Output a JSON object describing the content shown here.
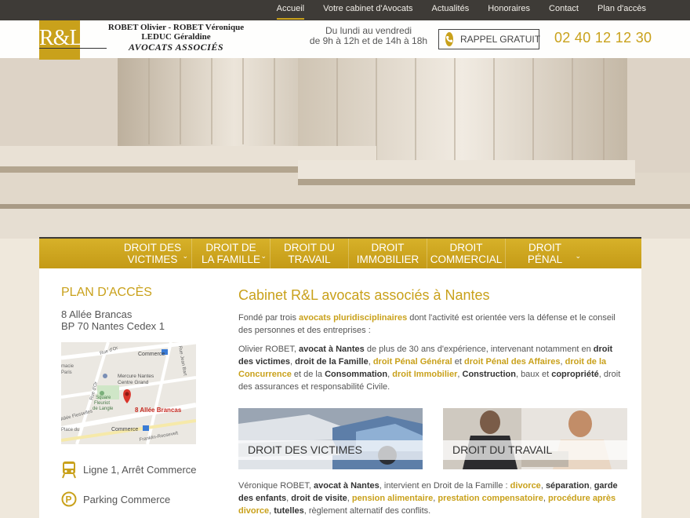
{
  "topnav": {
    "items": [
      {
        "label": "Accueil",
        "active": true
      },
      {
        "label": "Votre cabinet d'Avocats",
        "active": false
      },
      {
        "label": "Actualités",
        "active": false
      },
      {
        "label": "Honoraires",
        "active": false
      },
      {
        "label": "Contact",
        "active": false
      },
      {
        "label": "Plan d'accès",
        "active": false
      }
    ]
  },
  "header": {
    "logo_text": "R&L",
    "firm_line1": "ROBET Olivier - ROBET Véronique",
    "firm_line2": "LEDUC Géraldine",
    "firm_tagline": "AVOCATS ASSOCIÉS",
    "hours_line1": "Du lundi au vendredi",
    "hours_line2": "de 9h à 12h et de 14h à 18h",
    "callback_label": "RAPPEL GRATUIT",
    "phone": "02 40 12 12 30"
  },
  "practice_menu": [
    {
      "line1": "DROIT DES",
      "line2": "VICTIMES",
      "has_dropdown": true
    },
    {
      "line1": "DROIT DE",
      "line2": "LA FAMILLE",
      "has_dropdown": true
    },
    {
      "line1": "DROIT DU",
      "line2": "TRAVAIL",
      "has_dropdown": false
    },
    {
      "line1": "DROIT",
      "line2": "IMMOBILIER",
      "has_dropdown": false
    },
    {
      "line1": "DROIT",
      "line2": "COMMERCIAL",
      "has_dropdown": false
    },
    {
      "line1": "DROIT",
      "line2": "PÉNAL",
      "has_dropdown": true
    }
  ],
  "sidebar": {
    "title": "PLAN D'ACCÈS",
    "address_line1": "8 Allée Brancas",
    "address_line2": "BP 70 Nantes Cedex 1",
    "map_labels": {
      "commerce": "Commerce",
      "rue": "Rue d'Or",
      "hotel_line1": "Mercure Nantes",
      "hotel_line2": "Centre Grand",
      "square_line1": "Square",
      "square_line2": "Fleuriot",
      "square_line3": "de Langle",
      "pin_label": "8 Allée Brancas",
      "commerce2": "Commerce",
      "roosevelt": "Franklin-Roosevelt",
      "pharmacie": "macie",
      "paris": "Paris",
      "rue_jean": "Rue Jean Bart",
      "allee": "Allée Flesselles",
      "place": "Place du",
      "rue_oret": "Rue d'Or"
    },
    "transport": [
      {
        "icon": "tram-icon",
        "label": "Ligne 1, Arrêt Commerce"
      },
      {
        "icon": "parking-icon",
        "label": "Parking Commerce"
      }
    ]
  },
  "main": {
    "title": "Cabinet R&L avocats associés à Nantes",
    "p1": {
      "t1": "Fondé par trois ",
      "g1": "avocats pluridisciplinaires",
      "t2": " dont l'activité est orientée vers la défense et le conseil des personnes et des entreprises :"
    },
    "p2": {
      "t1": "Olivier ROBET, ",
      "b1": "avocat à Nantes",
      "t2": " de plus de 30 ans d'expérience, intervenant notamment en ",
      "b2": "droit des victimes",
      "t3": ", ",
      "b3": "droit de la Famille",
      "t4": ", ",
      "g1": "droit Pénal Général",
      "t5": " et ",
      "g2": "droit Pénal des Affaires",
      "t6": ", ",
      "g3": "droit de la Concurrence",
      "t7": " et de la ",
      "b4": "Consommation",
      "t8": ", ",
      "g4": "droit Immobilier",
      "t9": ", ",
      "b5": "Construction",
      "t10": ", baux et ",
      "b6": "copropriété",
      "t11": ", droit des assurances et responsabilité Civile."
    },
    "cards": [
      {
        "label": "DROIT DES VICTIMES"
      },
      {
        "label": "DROIT DU TRAVAIL"
      }
    ],
    "p3": {
      "t1": "Véronique ROBET, ",
      "b1": "avocat à Nantes",
      "t2": ", intervient en Droit de la Famille : ",
      "g1": "divorce",
      "t3": ", ",
      "b2": "séparation",
      "t4": ", ",
      "b3": "garde des enfants",
      "t5": ", ",
      "b4": "droit de visite",
      "t6": ", ",
      "g2": "pension alimentaire",
      "t7": ", ",
      "g3": "prestation compensatoire",
      "t8": ", ",
      "g4": "procédure après divorce",
      "t9": ", ",
      "b5": "tutelles",
      "t10": ", règlement alternatif des conflits."
    }
  },
  "colors": {
    "accent": "#c9a11b",
    "topbar": "#3e3b37",
    "text": "#555555"
  }
}
